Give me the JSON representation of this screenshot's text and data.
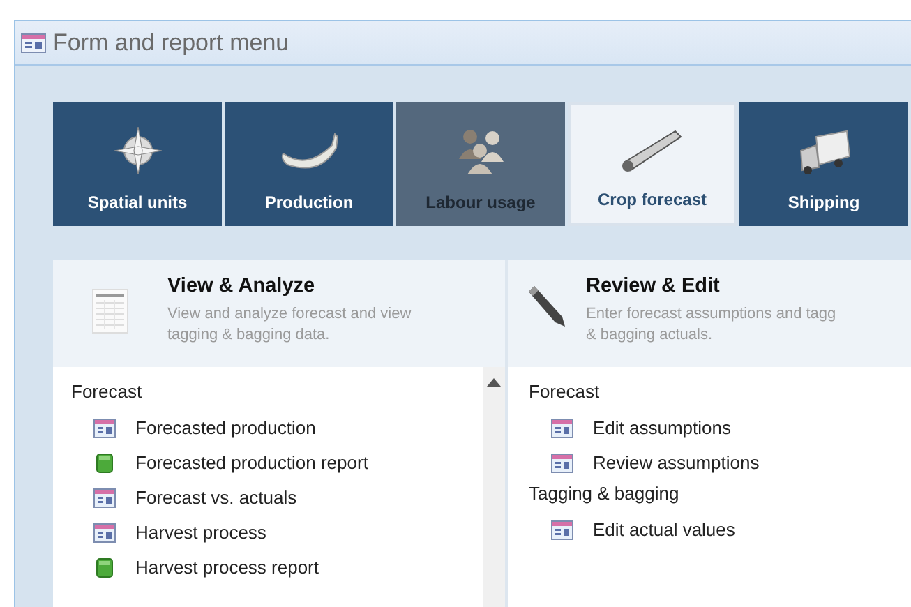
{
  "window": {
    "title": "Form and report menu"
  },
  "tiles": [
    {
      "label": "Spatial units",
      "selected": false,
      "disabled": false
    },
    {
      "label": "Production",
      "selected": false,
      "disabled": false
    },
    {
      "label": "Labour usage",
      "selected": false,
      "disabled": true
    },
    {
      "label": "Crop forecast",
      "selected": true,
      "disabled": false
    },
    {
      "label": "Shipping",
      "selected": false,
      "disabled": false
    }
  ],
  "panels": [
    {
      "title": "View & Analyze",
      "description_lines": [
        "View and analyze forecast and view",
        "tagging & bagging data."
      ],
      "groups": [
        {
          "heading": "Forecast",
          "items": [
            {
              "label": "Forecasted production",
              "kind": "form"
            },
            {
              "label": "Forecasted production report",
              "kind": "report"
            },
            {
              "label": "Forecast vs. actuals",
              "kind": "form"
            },
            {
              "label": "Harvest process",
              "kind": "form"
            },
            {
              "label": "Harvest process report",
              "kind": "report"
            }
          ]
        }
      ]
    },
    {
      "title": "Review & Edit",
      "description_lines": [
        "Enter forecast assumptions and  tagg",
        "& bagging actuals."
      ],
      "groups": [
        {
          "heading": "Forecast",
          "items": [
            {
              "label": "Edit assumptions",
              "kind": "form"
            },
            {
              "label": "Review assumptions",
              "kind": "form"
            }
          ]
        },
        {
          "heading": "Tagging & bagging",
          "items": [
            {
              "label": "Edit actual values",
              "kind": "form"
            }
          ]
        }
      ]
    }
  ]
}
